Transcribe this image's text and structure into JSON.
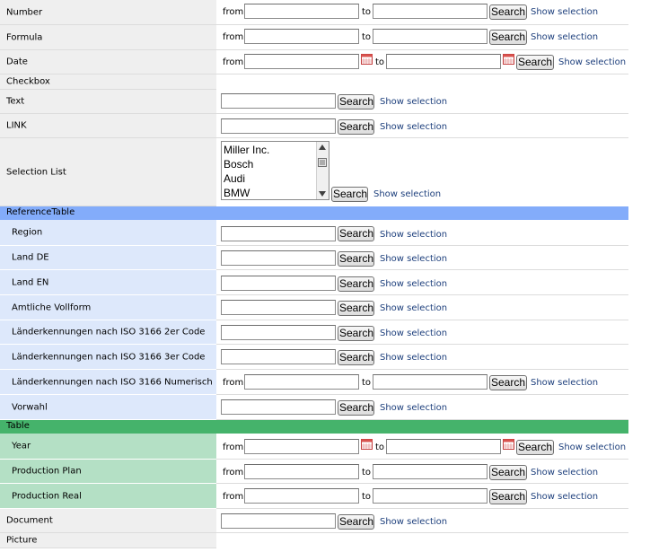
{
  "common": {
    "from": "from",
    "to": "to",
    "search": "Search",
    "show_selection": "Show selection"
  },
  "rows": {
    "number": "Number",
    "formula": "Formula",
    "date": "Date",
    "checkbox": "Checkbox",
    "text": "Text",
    "link": "LINK",
    "selection_list": "Selection List",
    "document": "Document",
    "picture": "Picture"
  },
  "selection_list": {
    "options": [
      "Miller Inc.",
      "Bosch",
      "Audi",
      "BMW"
    ]
  },
  "reference_table": {
    "title": "ReferenceTable",
    "color": "#83acfa",
    "rows": [
      "Region",
      "Land DE",
      "Land EN",
      "Amtliche Vollform",
      "Länderkennungen nach ISO 3166 2er Code",
      "Länderkennungen nach ISO 3166 3er Code",
      "Länderkennungen nach ISO 3166 Numerisch",
      "Vorwahl"
    ]
  },
  "table": {
    "title": "Table",
    "color": "#45b36b",
    "rows": [
      "Year",
      "Production Plan",
      "Production Real"
    ]
  },
  "icons": {
    "calendar": "calendar-icon",
    "scroll_up": "scroll-up-arrow-icon",
    "scroll_down": "scroll-down-arrow-icon",
    "scroll_grip": "scroll-grip-icon"
  }
}
